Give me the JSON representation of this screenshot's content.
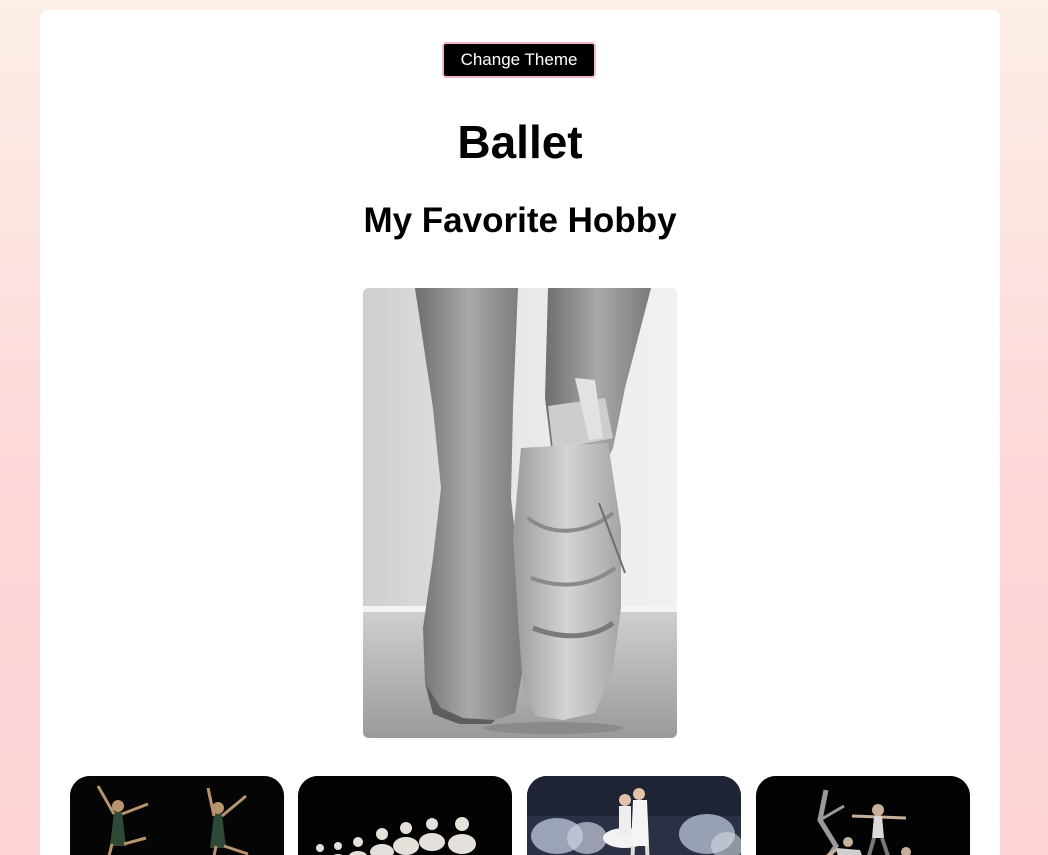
{
  "header": {
    "theme_button_label": "Change Theme"
  },
  "main": {
    "title": "Ballet",
    "subtitle": "My Favorite Hobby"
  },
  "images": {
    "hero": "pointe-shoe-photo",
    "gallery": [
      "dancers-leaping-photo",
      "ballerina-line-photo",
      "swan-lake-couple-photo",
      "contemporary-dance-photo"
    ]
  },
  "colors": {
    "page_background_top": "#fcefe7",
    "page_background_bottom": "#fdd3d6",
    "button_background": "#000000",
    "button_border": "#f6b9c6"
  }
}
